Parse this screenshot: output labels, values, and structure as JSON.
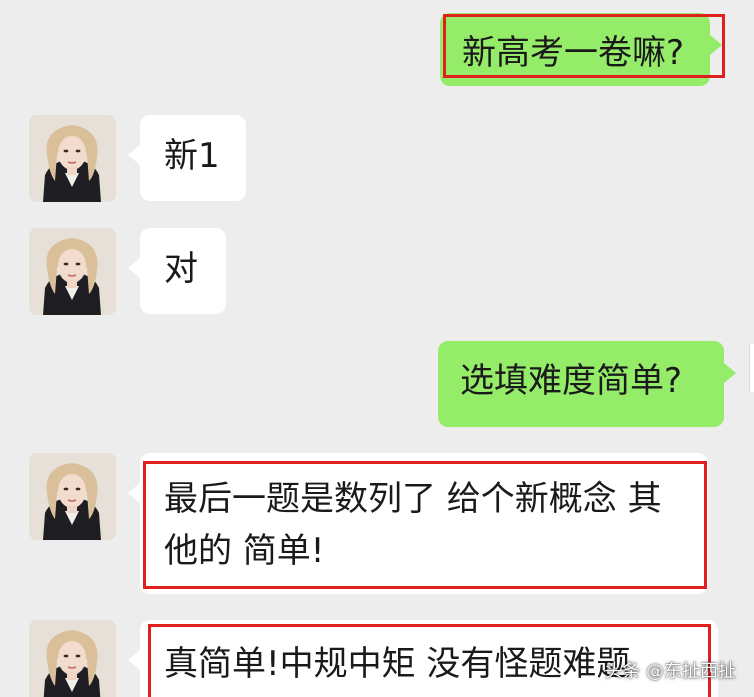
{
  "messages": [
    {
      "side": "out",
      "text": "新高考一卷嘛?"
    },
    {
      "side": "in",
      "text": "新1"
    },
    {
      "side": "in",
      "text": "对"
    },
    {
      "side": "out",
      "text": "选填难度简单?"
    },
    {
      "side": "in",
      "line1": "最后一题是数列了 给个新概念  其",
      "line2": "他的 简单!"
    },
    {
      "side": "in",
      "text": "真简单!中规中矩 没有怪题难题"
    }
  ],
  "avatar_icon": "contact-avatar-photo",
  "highlight_color": "#e0201c",
  "bubble_colors": {
    "outgoing": "#95ec69",
    "incoming": "#ffffff",
    "background": "#ededed"
  },
  "watermark": "头条 @东扯西扯"
}
